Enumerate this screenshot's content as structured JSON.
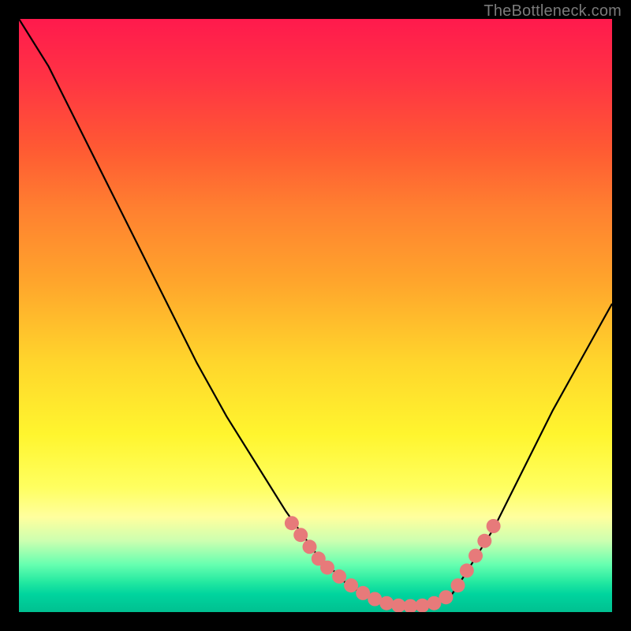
{
  "watermark": "TheBottleneck.com",
  "chart_data": {
    "type": "line",
    "title": "",
    "xlabel": "",
    "ylabel": "",
    "xlim": [
      0,
      100
    ],
    "ylim": [
      0,
      100
    ],
    "grid": false,
    "series": [
      {
        "name": "bottleneck-curve",
        "x": [
          0,
          5,
          10,
          15,
          20,
          25,
          30,
          35,
          40,
          45,
          50,
          55,
          58,
          60,
          63,
          65,
          68,
          70,
          73,
          75,
          80,
          85,
          90,
          95,
          100
        ],
        "y": [
          100,
          92,
          82,
          72,
          62,
          52,
          42,
          33,
          25,
          17,
          10,
          5,
          3,
          2,
          1,
          0.5,
          0.5,
          1,
          3,
          6,
          14,
          24,
          34,
          43,
          52
        ],
        "color": "#000000"
      }
    ],
    "markers": {
      "name": "highlight-dots",
      "color": "#e77a7a",
      "radius": 9,
      "x": [
        46,
        47.5,
        49,
        50.5,
        52,
        54,
        56,
        58,
        60,
        62,
        64,
        66,
        68,
        70,
        72,
        74,
        75.5,
        77,
        78.5,
        80
      ],
      "y": [
        15,
        13,
        11,
        9,
        7.5,
        6,
        4.5,
        3.2,
        2.2,
        1.5,
        1.1,
        1,
        1.1,
        1.5,
        2.5,
        4.5,
        7,
        9.5,
        12,
        14.5
      ]
    }
  }
}
